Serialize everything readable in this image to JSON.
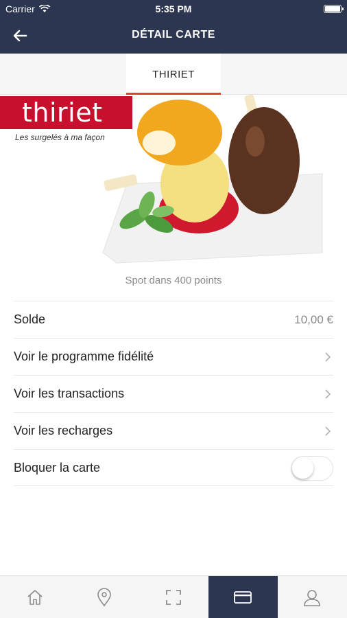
{
  "status_bar": {
    "carrier": "Carrier",
    "time": "5:35 PM"
  },
  "navbar": {
    "title": "DÉTAIL CARTE",
    "back_icon": "arrow-left-icon"
  },
  "tabs": [
    {
      "label": "THIRIET",
      "active": true
    }
  ],
  "card": {
    "brand_name": "thiriet",
    "tagline": "Les surgelés à ma façon",
    "brand_color": "#c8102e"
  },
  "spot_text": "Spot dans 400 points",
  "rows": [
    {
      "label": "Solde",
      "value": "10,00 €"
    },
    {
      "label": "Voir le programme fidélité"
    },
    {
      "label": "Voir les transactions"
    },
    {
      "label": "Voir les recharges"
    },
    {
      "label": "Bloquer la carte",
      "toggle": false
    }
  ],
  "bottom_nav": [
    {
      "icon": "home-icon"
    },
    {
      "icon": "location-pin-icon"
    },
    {
      "icon": "scan-icon"
    },
    {
      "icon": "card-icon",
      "active": true
    },
    {
      "icon": "user-icon"
    }
  ],
  "colors": {
    "navbar": "#2c3650",
    "accent": "#e2421e"
  }
}
